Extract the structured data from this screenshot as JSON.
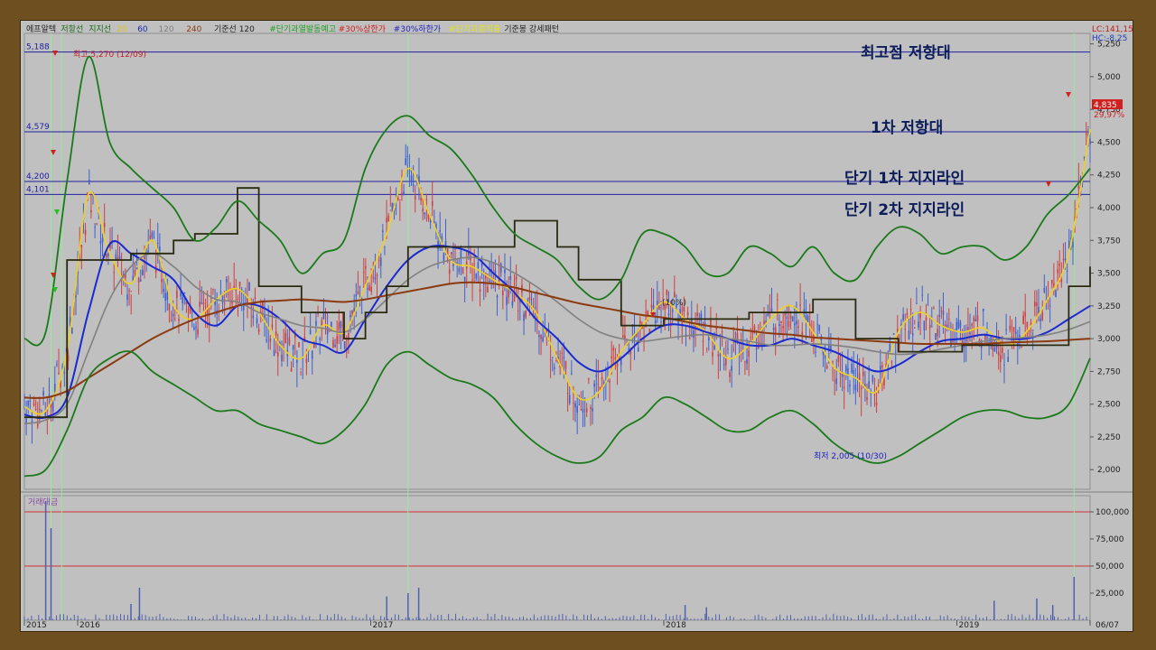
{
  "toolbar": {
    "items": [
      {
        "text": "에프알텍",
        "color": "#222222"
      },
      {
        "text": "저항선",
        "color": "#1c6a1c"
      },
      {
        "text": "지지선",
        "color": "#1c6a1c"
      },
      {
        "text": "20",
        "color": "#e0c020"
      },
      {
        "text": "60",
        "color": "#1a2ab0"
      },
      {
        "text": "120",
        "color": "#808080"
      },
      {
        "text": "240",
        "color": "#8b3a10"
      },
      {
        "text": "기준선 120",
        "color": "#222222"
      },
      {
        "text": "#단기과열발동예고",
        "color": "#20a020"
      },
      {
        "text": "#30%상한가",
        "color": "#d02020"
      },
      {
        "text": "#30%하한가",
        "color": "#2020c0"
      },
      {
        "text": "#단기과열적출",
        "color": "#e0e020"
      },
      {
        "text": "기준봉 강세패턴",
        "color": "#222222"
      }
    ]
  },
  "price_box": {
    "lc": "LC:141,15",
    "hc": "HC:-8,25",
    "last": "4,835",
    "change": "29,97%"
  },
  "annotations": {
    "top_resistance": "최고점 저항대",
    "first_resistance": "1차 저항대",
    "support_1": "단기 1차 지지라인",
    "support_2": "단기 2차 지지라인",
    "high_marker": "최고 5,270 (12/09)",
    "low_marker": "최저 2,005 (10/30)",
    "center_pct": "(10%)"
  },
  "level_labels": [
    "5,188",
    "4,579",
    "4,200",
    "4,101"
  ],
  "volume_panel": {
    "title": "거래대금"
  },
  "colors": {
    "bollinger": "#1a7a1a",
    "ma20": "#f0d020",
    "ma60": "#1a2ad0",
    "ma120": "#808080",
    "ma240": "#8b3a10",
    "baseline": "#2a2a10",
    "hline": "#2020a0",
    "vol_hline": "#d03030"
  },
  "chart_data": [
    {
      "type": "line",
      "title": "에프알텍",
      "x_ticks": [
        "2015",
        "2016",
        "2017",
        "2018",
        "2019",
        "06/07"
      ],
      "ylim": [
        1850,
        5330
      ],
      "y_ticks": [
        "5,250",
        "5,000",
        "4,750",
        "4,500",
        "4,250",
        "4,000",
        "3,750",
        "3,500",
        "3,250",
        "3,000",
        "2,750",
        "2,500",
        "2,250",
        "2,000"
      ],
      "y_tick_values": [
        5250,
        5000,
        4750,
        4500,
        4250,
        4000,
        3750,
        3500,
        3250,
        3000,
        2750,
        2500,
        2250,
        2000
      ],
      "horizontal_levels": [
        5188,
        4579,
        4200,
        4101
      ],
      "high": {
        "value": 5270,
        "date": "12/09"
      },
      "low": {
        "value": 2005,
        "date": "10/30"
      },
      "last_close": 4835,
      "series": [
        {
          "name": "20",
          "values": [
            2480,
            2450,
            2900,
            4100,
            3650,
            3420,
            3750,
            3250,
            3150,
            3300,
            3380,
            3200,
            2950,
            2850,
            3100,
            3050,
            3400,
            3800,
            4300,
            3950,
            3600,
            3550,
            3450,
            3350,
            3200,
            2850,
            2550,
            2600,
            2900,
            3100,
            3280,
            3150,
            3050,
            2850,
            2950,
            3150,
            3250,
            3050,
            2780,
            2700,
            2600,
            3050,
            3200,
            3100,
            3050,
            3080,
            2950,
            3050,
            3300,
            3650,
            4600
          ]
        },
        {
          "name": "60",
          "values": [
            2420,
            2400,
            2550,
            3200,
            3720,
            3650,
            3550,
            3450,
            3200,
            3100,
            3250,
            3250,
            3150,
            3000,
            2950,
            2900,
            3150,
            3400,
            3600,
            3700,
            3700,
            3650,
            3500,
            3350,
            3150,
            3000,
            2820,
            2750,
            2850,
            3000,
            3100,
            3100,
            3050,
            3000,
            2950,
            2950,
            3000,
            2950,
            2900,
            2820,
            2750,
            2800,
            2900,
            2980,
            3000,
            3030,
            3000,
            3000,
            3050,
            3150,
            3250
          ]
        },
        {
          "name": "120",
          "values": [
            2350,
            2380,
            2500,
            2900,
            3300,
            3550,
            3650,
            3550,
            3400,
            3300,
            3280,
            3200,
            3150,
            3100,
            3080,
            3050,
            3150,
            3300,
            3450,
            3550,
            3600,
            3620,
            3580,
            3500,
            3400,
            3280,
            3150,
            3050,
            3000,
            2980,
            3000,
            3020,
            3030,
            3000,
            2980,
            2950,
            2950,
            2960,
            2950,
            2930,
            2900,
            2880,
            2890,
            2920,
            2950,
            2980,
            3000,
            3010,
            3030,
            3070,
            3130
          ]
        },
        {
          "name": "240",
          "values": [
            2550,
            2550,
            2600,
            2700,
            2800,
            2900,
            3000,
            3080,
            3150,
            3200,
            3250,
            3280,
            3290,
            3300,
            3290,
            3280,
            3300,
            3330,
            3360,
            3390,
            3420,
            3430,
            3420,
            3390,
            3350,
            3310,
            3270,
            3240,
            3210,
            3180,
            3160,
            3130,
            3100,
            3080,
            3060,
            3040,
            3030,
            3010,
            3000,
            2990,
            2980,
            2970,
            2960,
            2960,
            2960,
            2960,
            2970,
            2975,
            2980,
            2990,
            3000
          ]
        },
        {
          "name": "기준선",
          "values": [
            2400,
            2400,
            3600,
            3600,
            3600,
            3650,
            3650,
            3750,
            3800,
            3800,
            4150,
            3400,
            3400,
            3200,
            3200,
            3000,
            3200,
            3400,
            3700,
            3700,
            3700,
            3700,
            3700,
            3900,
            3900,
            3700,
            3450,
            3450,
            3100,
            3100,
            3150,
            3150,
            3150,
            3150,
            3200,
            3200,
            3200,
            3300,
            3300,
            3000,
            3000,
            2900,
            2900,
            2900,
            2950,
            2950,
            2950,
            2950,
            2950,
            3400,
            3550
          ]
        },
        {
          "name": "bollinger-upper",
          "values": [
            3000,
            3050,
            4200,
            5150,
            4500,
            4300,
            4150,
            4000,
            3750,
            3850,
            4050,
            3900,
            3750,
            3500,
            3650,
            3750,
            4300,
            4600,
            4700,
            4550,
            4450,
            4250,
            4000,
            3800,
            3700,
            3600,
            3400,
            3300,
            3450,
            3800,
            3800,
            3700,
            3500,
            3500,
            3700,
            3650,
            3550,
            3700,
            3500,
            3450,
            3700,
            3850,
            3800,
            3650,
            3700,
            3700,
            3600,
            3700,
            3950,
            4100,
            4300
          ]
        },
        {
          "name": "bollinger-lower",
          "values": [
            1950,
            2000,
            2300,
            2700,
            2850,
            2900,
            2750,
            2650,
            2550,
            2450,
            2450,
            2350,
            2300,
            2250,
            2200,
            2300,
            2500,
            2800,
            2900,
            2800,
            2700,
            2650,
            2550,
            2350,
            2200,
            2100,
            2050,
            2100,
            2300,
            2400,
            2550,
            2500,
            2400,
            2300,
            2300,
            2400,
            2450,
            2350,
            2200,
            2100,
            2050,
            2100,
            2200,
            2300,
            2400,
            2450,
            2450,
            2400,
            2400,
            2500,
            2850
          ]
        }
      ],
      "volume": {
        "ylim": [
          0,
          115000
        ],
        "y_ticks": [
          "100,000",
          "75,000",
          "50,000",
          "25,000"
        ],
        "y_tick_values": [
          100000,
          75000,
          50000,
          25000
        ],
        "reference_lines": [
          100000,
          50000
        ],
        "spikes": [
          {
            "x": 0.02,
            "v": 110000
          },
          {
            "x": 0.025,
            "v": 85000
          },
          {
            "x": 0.1,
            "v": 15000
          },
          {
            "x": 0.108,
            "v": 30000
          },
          {
            "x": 0.34,
            "v": 22000
          },
          {
            "x": 0.36,
            "v": 25000
          },
          {
            "x": 0.37,
            "v": 30000
          },
          {
            "x": 0.62,
            "v": 14000
          },
          {
            "x": 0.64,
            "v": 12000
          },
          {
            "x": 0.91,
            "v": 18000
          },
          {
            "x": 0.95,
            "v": 20000
          },
          {
            "x": 0.965,
            "v": 14000
          },
          {
            "x": 0.985,
            "v": 40000
          }
        ]
      }
    }
  ]
}
